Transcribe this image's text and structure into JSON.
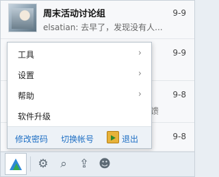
{
  "conversations": [
    {
      "title": "周末活动讨论组",
      "preview": "elsatian: 去早了，发现没有人...",
      "date": "9-9"
    },
    {
      "date": "9-9"
    },
    {
      "date": "9-8",
      "preview_tail": "馈"
    },
    {
      "date": "9-8"
    }
  ],
  "menu": {
    "items": [
      {
        "label": "工具",
        "has_submenu": true,
        "chevron": "›"
      },
      {
        "label": "设置",
        "has_submenu": true,
        "chevron": "›"
      },
      {
        "label": "帮助",
        "has_submenu": true,
        "chevron": "›"
      },
      {
        "label": "软件升级",
        "has_submenu": false
      }
    ],
    "footer": {
      "change_password": "修改密码",
      "switch_account": "切换帐号",
      "logout": "退出"
    }
  },
  "toolbar": {
    "icons": [
      "app-logo-icon",
      "gear-icon",
      "search-icon",
      "upload-icon",
      "user-settings-icon"
    ],
    "glyphs": {
      "gear": "⚙",
      "search": "⌕",
      "upload": "⇪",
      "user": "☻"
    }
  },
  "colors": {
    "link": "#1e6fc4",
    "menu_bg": "#ffffff",
    "footer_bg": "#edf2f7"
  }
}
